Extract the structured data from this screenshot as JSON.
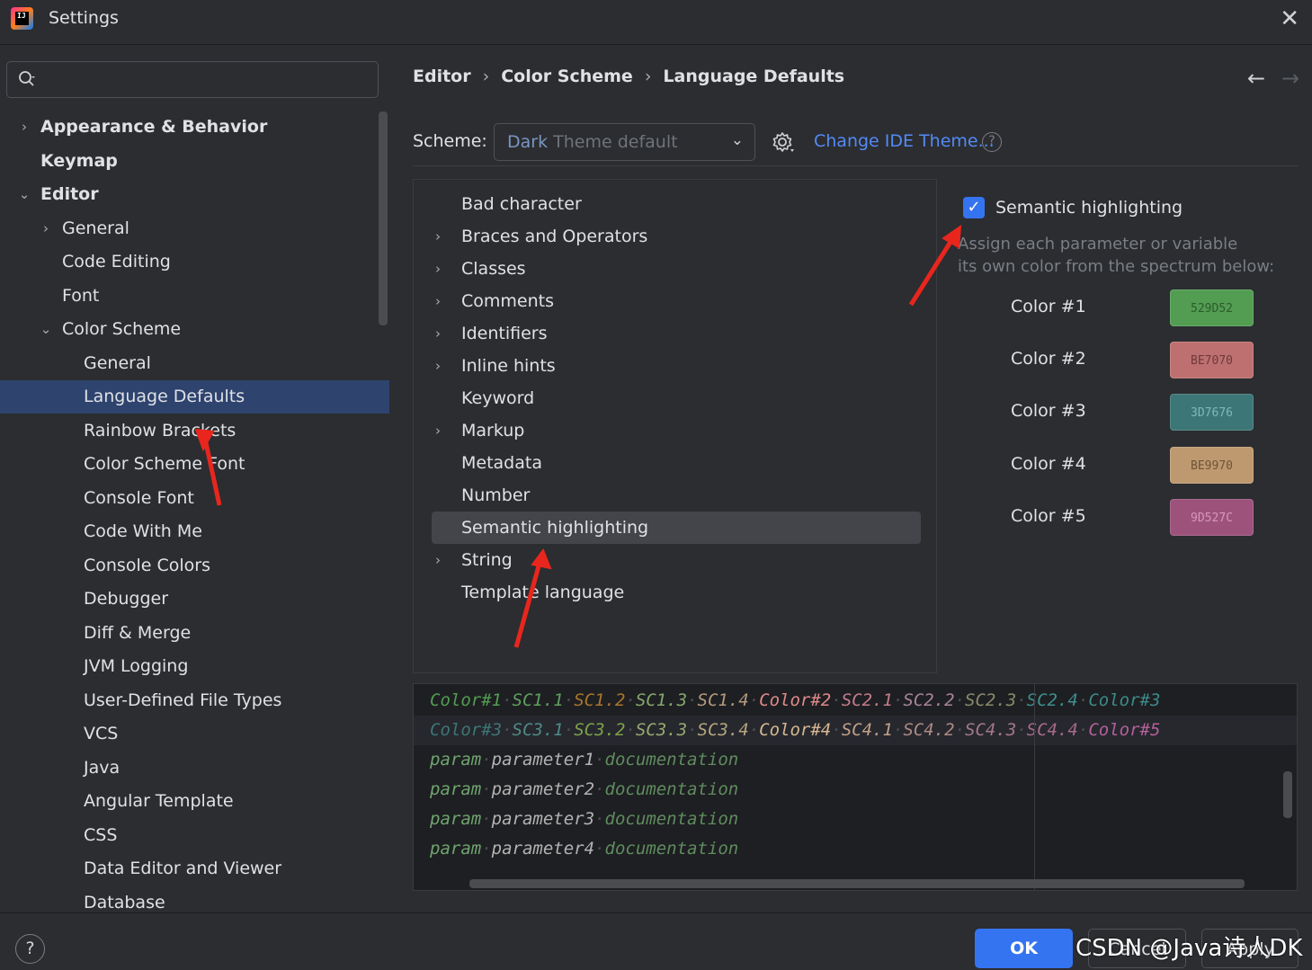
{
  "window": {
    "title": "Settings",
    "close_glyph": "✕"
  },
  "sidebar": {
    "search": {
      "value": "",
      "placeholder": ""
    },
    "items": [
      {
        "label": "Appearance & Behavior",
        "arrow": "›",
        "bold": true
      },
      {
        "label": "Keymap",
        "arrow": "",
        "bold": true
      },
      {
        "label": "Editor",
        "arrow": "⌄",
        "bold": true
      },
      {
        "label": "General",
        "arrow": "›"
      },
      {
        "label": "Code Editing",
        "arrow": ""
      },
      {
        "label": "Font",
        "arrow": ""
      },
      {
        "label": "Color Scheme",
        "arrow": "⌄"
      },
      {
        "label": "General",
        "arrow": ""
      },
      {
        "label": "Language Defaults",
        "arrow": "",
        "selected": true
      },
      {
        "label": "Rainbow Brackets",
        "arrow": ""
      },
      {
        "label": "Color Scheme Font",
        "arrow": ""
      },
      {
        "label": "Console Font",
        "arrow": ""
      },
      {
        "label": "Code With Me",
        "arrow": ""
      },
      {
        "label": "Console Colors",
        "arrow": ""
      },
      {
        "label": "Debugger",
        "arrow": ""
      },
      {
        "label": "Diff & Merge",
        "arrow": ""
      },
      {
        "label": "JVM Logging",
        "arrow": ""
      },
      {
        "label": "User-Defined File Types",
        "arrow": ""
      },
      {
        "label": "VCS",
        "arrow": ""
      },
      {
        "label": "Java",
        "arrow": ""
      },
      {
        "label": "Angular Template",
        "arrow": ""
      },
      {
        "label": "CSS",
        "arrow": ""
      },
      {
        "label": "Data Editor and Viewer",
        "arrow": ""
      },
      {
        "label": "Database",
        "arrow": ""
      }
    ]
  },
  "breadcrumb": {
    "items": [
      "Editor",
      "Color Scheme",
      "Language Defaults"
    ],
    "separator": "›"
  },
  "nav": {
    "back": "←",
    "forward": "→"
  },
  "scheme": {
    "label": "Scheme:",
    "value_accent": "Dark",
    "value_rest": " Theme default",
    "chevron": "⌄",
    "change_theme_link": "Change IDE Theme...",
    "help": "?"
  },
  "attributes": [
    {
      "label": "Bad character",
      "arrow": ""
    },
    {
      "label": "Braces and Operators",
      "arrow": "›"
    },
    {
      "label": "Classes",
      "arrow": "›"
    },
    {
      "label": "Comments",
      "arrow": "›"
    },
    {
      "label": "Identifiers",
      "arrow": "›"
    },
    {
      "label": "Inline hints",
      "arrow": "›"
    },
    {
      "label": "Keyword",
      "arrow": ""
    },
    {
      "label": "Markup",
      "arrow": "›"
    },
    {
      "label": "Metadata",
      "arrow": ""
    },
    {
      "label": "Number",
      "arrow": ""
    },
    {
      "label": "Semantic highlighting",
      "arrow": "",
      "selected": true
    },
    {
      "label": "String",
      "arrow": "›"
    },
    {
      "label": "Template language",
      "arrow": ""
    }
  ],
  "semantic": {
    "checkbox_label": "Semantic highlighting",
    "checked": true,
    "check_glyph": "✓",
    "description_line1": "Assign each parameter or variable",
    "description_line2": "its own color from the spectrum below:",
    "colors": [
      {
        "label": "Color #1",
        "hex": "529D52",
        "bg": "#529d52",
        "fg": "#2d5a2d"
      },
      {
        "label": "Color #2",
        "hex": "BE7070",
        "bg": "#be7070",
        "fg": "#6e3a3a"
      },
      {
        "label": "Color #3",
        "hex": "3D7676",
        "bg": "#3d7676",
        "fg": "#7fb8b8"
      },
      {
        "label": "Color #4",
        "hex": "BE9970",
        "bg": "#be9970",
        "fg": "#6e5436"
      },
      {
        "label": "Color #5",
        "hex": "9D527C",
        "bg": "#9d527c",
        "fg": "#d896bb"
      }
    ]
  },
  "preview": {
    "lines": [
      [
        {
          "t": "Color#1",
          "c": "#529d52"
        },
        {
          "t": " SC1.1",
          "c": "#5fa05f"
        },
        {
          "t": " SC1.2",
          "c": "#a8762c"
        },
        {
          "t": " SC1.3",
          "c": "#86a86e"
        },
        {
          "t": " SC1.4",
          "c": "#b49a7e"
        },
        {
          "t": " Color#2",
          "c": "#e08a8a"
        },
        {
          "t": " SC2.1",
          "c": "#c47c8a"
        },
        {
          "t": " SC2.2",
          "c": "#a8849a"
        },
        {
          "t": " SC2.3",
          "c": "#8a8a6a"
        },
        {
          "t": " SC2.4",
          "c": "#3f8f8f"
        },
        {
          "t": " Color#3",
          "c": "#3d8a8a"
        }
      ],
      [
        {
          "t": "Color#3",
          "c": "#3d7676"
        },
        {
          "t": " SC3.1",
          "c": "#4f8a86"
        },
        {
          "t": " SC3.2",
          "c": "#7ea24a"
        },
        {
          "t": " SC3.3",
          "c": "#9aa86e"
        },
        {
          "t": " SC3.4",
          "c": "#b6a67e"
        },
        {
          "t": " Color#4",
          "c": "#d8b892"
        },
        {
          "t": " SC4.1",
          "c": "#c4a086"
        },
        {
          "t": " SC4.2",
          "c": "#b08a86"
        },
        {
          "t": " SC4.3",
          "c": "#a4788a"
        },
        {
          "t": " SC4.4",
          "c": "#a86a8a"
        },
        {
          "t": " Color#5",
          "c": "#b5609a"
        }
      ],
      [
        {
          "t": "param",
          "c": "#6fa56f"
        },
        {
          "t": " parameter1",
          "c": "#b3b3b3"
        },
        {
          "t": " documentation",
          "c": "#5f8c5f"
        }
      ],
      [
        {
          "t": "param",
          "c": "#6fa56f"
        },
        {
          "t": " parameter2",
          "c": "#b3b3b3"
        },
        {
          "t": " documentation",
          "c": "#5f8c5f"
        }
      ],
      [
        {
          "t": "param",
          "c": "#6fa56f"
        },
        {
          "t": " parameter3",
          "c": "#b3b3b3"
        },
        {
          "t": " documentation",
          "c": "#5f8c5f"
        }
      ],
      [
        {
          "t": "param",
          "c": "#6fa56f"
        },
        {
          "t": " parameter4",
          "c": "#b3b3b3"
        },
        {
          "t": " documentation",
          "c": "#5f8c5f"
        }
      ]
    ]
  },
  "footer": {
    "help": "?",
    "ok": "OK",
    "cancel": "Cancel",
    "apply": "Apply",
    "watermark": "CSDN @Java诗人DK"
  },
  "accent_color": "#3574f0",
  "annotation_color": "#e8261e"
}
